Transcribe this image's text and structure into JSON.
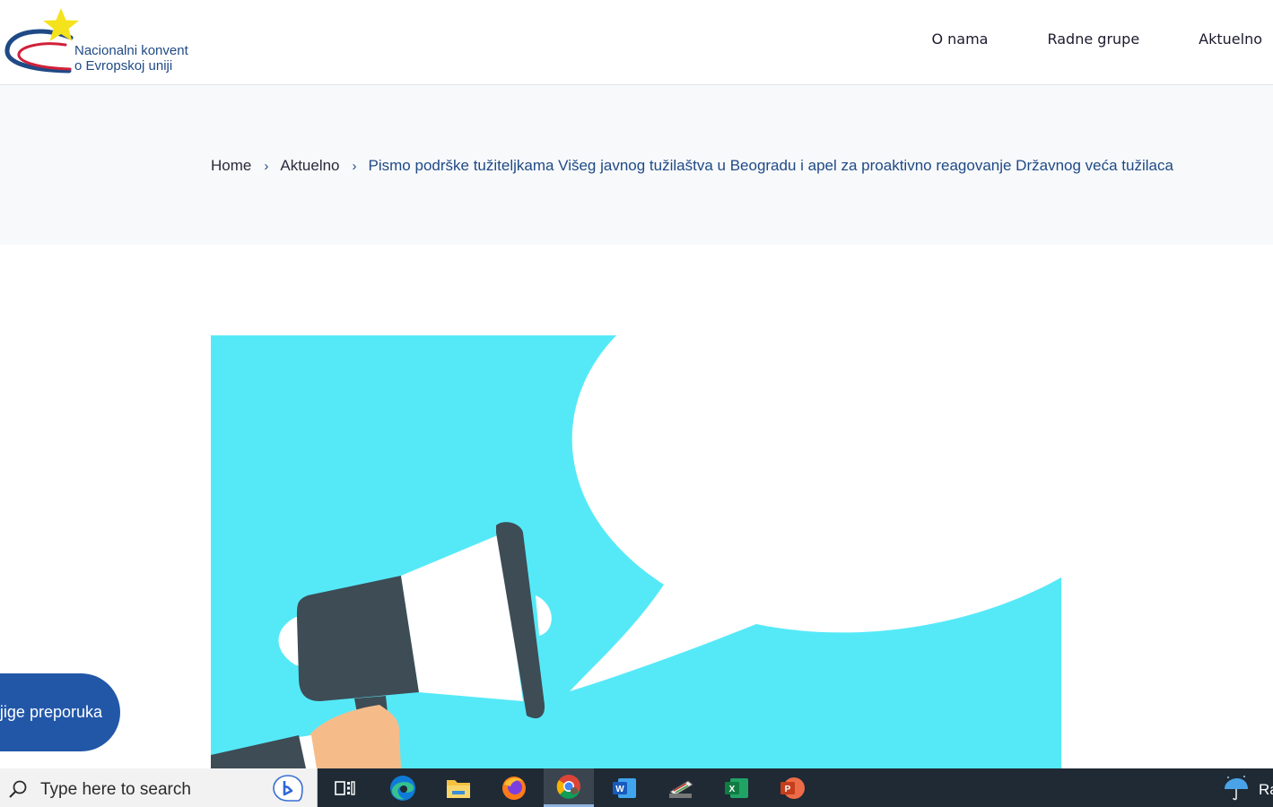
{
  "logo": {
    "line1": "Nacionalni konvent",
    "line2": "o Evropskoj uniji",
    "colors": {
      "star": "#f4e21c",
      "swoosh_blue": "#1f4a86",
      "swoosh_red": "#d0213a"
    }
  },
  "nav": {
    "items": [
      {
        "label": "O nama"
      },
      {
        "label": "Radne grupe"
      },
      {
        "label": "Aktuelno"
      }
    ]
  },
  "breadcrumb": {
    "items": [
      {
        "label": "Home"
      },
      {
        "label": "Aktuelno"
      }
    ],
    "current": "Pismo podrške tužiteljkama Višeg javnog tužilaštva u Beogradu i apel za proaktivno reagovanje Državnog veća tužilaca",
    "separator": "›"
  },
  "hero": {
    "colors": {
      "background": "#55e9f8",
      "bubble": "#ffffff",
      "megaphone_dark": "#3e4c55",
      "hand": "#f5bc8a"
    }
  },
  "float_button": {
    "label": "Knjige preporuka",
    "color": "#2257a8"
  },
  "taskbar": {
    "search_placeholder": "Type here to search",
    "apps": [
      {
        "icon": "task-view-icon"
      },
      {
        "icon": "edge-icon"
      },
      {
        "icon": "file-explorer-icon"
      },
      {
        "icon": "firefox-icon"
      },
      {
        "icon": "chrome-icon",
        "active": true
      },
      {
        "icon": "word-icon"
      },
      {
        "icon": "scanner-icon"
      },
      {
        "icon": "excel-icon"
      },
      {
        "icon": "powerpoint-icon"
      }
    ],
    "weather_text": "Ra"
  }
}
